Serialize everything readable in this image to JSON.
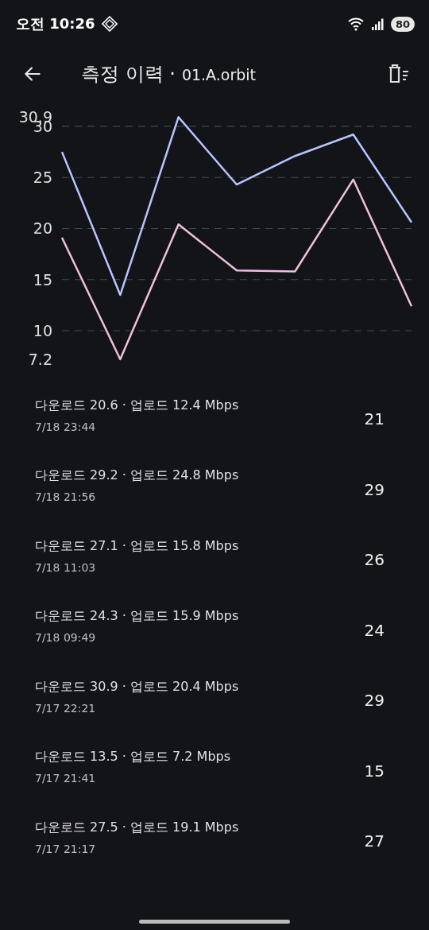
{
  "status_bar": {
    "time": "오전 10:26",
    "battery": "80"
  },
  "header": {
    "title": "측정 이력 ·",
    "subtitle": "01.A.orbit"
  },
  "chart": {
    "chart_data": {
      "type": "line",
      "grid": true,
      "series": [
        {
          "color": "#b8c4ff",
          "values": [
            27.5,
            13.5,
            30.9,
            24.3,
            27.1,
            29.2,
            20.6
          ]
        },
        {
          "color": "#efbfdf",
          "values": [
            19.1,
            7.2,
            20.4,
            15.9,
            15.8,
            24.8,
            12.4
          ]
        }
      ],
      "ylim": [
        7.2,
        30.9
      ],
      "yticks": [
        {
          "value": 30.9,
          "label": "30.9"
        },
        30,
        25,
        20,
        15,
        10,
        {
          "value": 7.2,
          "label": "7.2"
        }
      ]
    }
  },
  "records": [
    {
      "speeds": "다운로드 20.6 · 업로드 12.4 Mbps",
      "time": "7/18 23:44",
      "score": "21"
    },
    {
      "speeds": "다운로드 29.2 · 업로드 24.8 Mbps",
      "time": "7/18 21:56",
      "score": "29"
    },
    {
      "speeds": "다운로드 27.1 · 업로드 15.8 Mbps",
      "time": "7/18 11:03",
      "score": "26"
    },
    {
      "speeds": "다운로드 24.3 · 업로드 15.9 Mbps",
      "time": "7/18 09:49",
      "score": "24"
    },
    {
      "speeds": "다운로드 30.9 · 업로드 20.4 Mbps",
      "time": "7/17 22:21",
      "score": "29"
    },
    {
      "speeds": "다운로드 13.5 · 업로드 7.2 Mbps",
      "time": "7/17 21:41",
      "score": "15"
    },
    {
      "speeds": "다운로드 27.5 · 업로드 19.1 Mbps",
      "time": "7/17 21:17",
      "score": "27"
    }
  ]
}
